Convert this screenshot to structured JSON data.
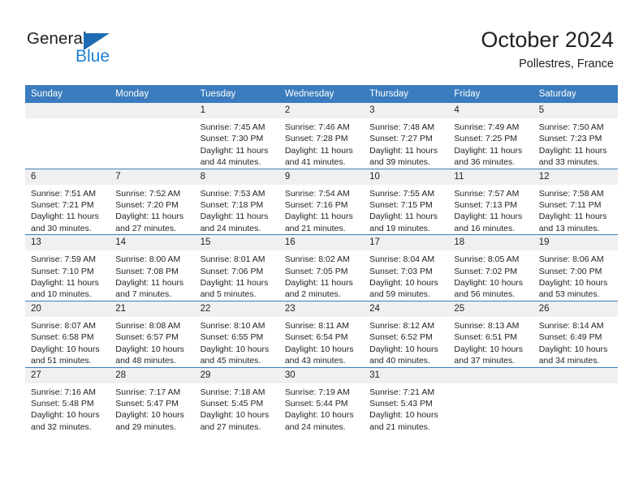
{
  "brand": {
    "name_part1": "General",
    "name_part2": "Blue",
    "color_dark": "#231f20",
    "color_blue": "#1f7fd0",
    "triangle_color": "#1f6cb4"
  },
  "header": {
    "title": "October 2024",
    "subtitle": "Pollestres, France"
  },
  "theme": {
    "header_blue": "#3a7cbe",
    "daynum_bg": "#f0f0f0",
    "cell_bg": "#ffffff",
    "text": "#231f20"
  },
  "weekdays": [
    "Sunday",
    "Monday",
    "Tuesday",
    "Wednesday",
    "Thursday",
    "Friday",
    "Saturday"
  ],
  "weeks": [
    [
      {
        "day": "",
        "sunrise": "",
        "sunset": "",
        "daylight": "",
        "empty": true
      },
      {
        "day": "",
        "sunrise": "",
        "sunset": "",
        "daylight": "",
        "empty": true
      },
      {
        "day": "1",
        "sunrise": "Sunrise: 7:45 AM",
        "sunset": "Sunset: 7:30 PM",
        "daylight": "Daylight: 11 hours and 44 minutes.",
        "empty": false
      },
      {
        "day": "2",
        "sunrise": "Sunrise: 7:46 AM",
        "sunset": "Sunset: 7:28 PM",
        "daylight": "Daylight: 11 hours and 41 minutes.",
        "empty": false
      },
      {
        "day": "3",
        "sunrise": "Sunrise: 7:48 AM",
        "sunset": "Sunset: 7:27 PM",
        "daylight": "Daylight: 11 hours and 39 minutes.",
        "empty": false
      },
      {
        "day": "4",
        "sunrise": "Sunrise: 7:49 AM",
        "sunset": "Sunset: 7:25 PM",
        "daylight": "Daylight: 11 hours and 36 minutes.",
        "empty": false
      },
      {
        "day": "5",
        "sunrise": "Sunrise: 7:50 AM",
        "sunset": "Sunset: 7:23 PM",
        "daylight": "Daylight: 11 hours and 33 minutes.",
        "empty": false
      }
    ],
    [
      {
        "day": "6",
        "sunrise": "Sunrise: 7:51 AM",
        "sunset": "Sunset: 7:21 PM",
        "daylight": "Daylight: 11 hours and 30 minutes.",
        "empty": false
      },
      {
        "day": "7",
        "sunrise": "Sunrise: 7:52 AM",
        "sunset": "Sunset: 7:20 PM",
        "daylight": "Daylight: 11 hours and 27 minutes.",
        "empty": false
      },
      {
        "day": "8",
        "sunrise": "Sunrise: 7:53 AM",
        "sunset": "Sunset: 7:18 PM",
        "daylight": "Daylight: 11 hours and 24 minutes.",
        "empty": false
      },
      {
        "day": "9",
        "sunrise": "Sunrise: 7:54 AM",
        "sunset": "Sunset: 7:16 PM",
        "daylight": "Daylight: 11 hours and 21 minutes.",
        "empty": false
      },
      {
        "day": "10",
        "sunrise": "Sunrise: 7:55 AM",
        "sunset": "Sunset: 7:15 PM",
        "daylight": "Daylight: 11 hours and 19 minutes.",
        "empty": false
      },
      {
        "day": "11",
        "sunrise": "Sunrise: 7:57 AM",
        "sunset": "Sunset: 7:13 PM",
        "daylight": "Daylight: 11 hours and 16 minutes.",
        "empty": false
      },
      {
        "day": "12",
        "sunrise": "Sunrise: 7:58 AM",
        "sunset": "Sunset: 7:11 PM",
        "daylight": "Daylight: 11 hours and 13 minutes.",
        "empty": false
      }
    ],
    [
      {
        "day": "13",
        "sunrise": "Sunrise: 7:59 AM",
        "sunset": "Sunset: 7:10 PM",
        "daylight": "Daylight: 11 hours and 10 minutes.",
        "empty": false
      },
      {
        "day": "14",
        "sunrise": "Sunrise: 8:00 AM",
        "sunset": "Sunset: 7:08 PM",
        "daylight": "Daylight: 11 hours and 7 minutes.",
        "empty": false
      },
      {
        "day": "15",
        "sunrise": "Sunrise: 8:01 AM",
        "sunset": "Sunset: 7:06 PM",
        "daylight": "Daylight: 11 hours and 5 minutes.",
        "empty": false
      },
      {
        "day": "16",
        "sunrise": "Sunrise: 8:02 AM",
        "sunset": "Sunset: 7:05 PM",
        "daylight": "Daylight: 11 hours and 2 minutes.",
        "empty": false
      },
      {
        "day": "17",
        "sunrise": "Sunrise: 8:04 AM",
        "sunset": "Sunset: 7:03 PM",
        "daylight": "Daylight: 10 hours and 59 minutes.",
        "empty": false
      },
      {
        "day": "18",
        "sunrise": "Sunrise: 8:05 AM",
        "sunset": "Sunset: 7:02 PM",
        "daylight": "Daylight: 10 hours and 56 minutes.",
        "empty": false
      },
      {
        "day": "19",
        "sunrise": "Sunrise: 8:06 AM",
        "sunset": "Sunset: 7:00 PM",
        "daylight": "Daylight: 10 hours and 53 minutes.",
        "empty": false
      }
    ],
    [
      {
        "day": "20",
        "sunrise": "Sunrise: 8:07 AM",
        "sunset": "Sunset: 6:58 PM",
        "daylight": "Daylight: 10 hours and 51 minutes.",
        "empty": false
      },
      {
        "day": "21",
        "sunrise": "Sunrise: 8:08 AM",
        "sunset": "Sunset: 6:57 PM",
        "daylight": "Daylight: 10 hours and 48 minutes.",
        "empty": false
      },
      {
        "day": "22",
        "sunrise": "Sunrise: 8:10 AM",
        "sunset": "Sunset: 6:55 PM",
        "daylight": "Daylight: 10 hours and 45 minutes.",
        "empty": false
      },
      {
        "day": "23",
        "sunrise": "Sunrise: 8:11 AM",
        "sunset": "Sunset: 6:54 PM",
        "daylight": "Daylight: 10 hours and 43 minutes.",
        "empty": false
      },
      {
        "day": "24",
        "sunrise": "Sunrise: 8:12 AM",
        "sunset": "Sunset: 6:52 PM",
        "daylight": "Daylight: 10 hours and 40 minutes.",
        "empty": false
      },
      {
        "day": "25",
        "sunrise": "Sunrise: 8:13 AM",
        "sunset": "Sunset: 6:51 PM",
        "daylight": "Daylight: 10 hours and 37 minutes.",
        "empty": false
      },
      {
        "day": "26",
        "sunrise": "Sunrise: 8:14 AM",
        "sunset": "Sunset: 6:49 PM",
        "daylight": "Daylight: 10 hours and 34 minutes.",
        "empty": false
      }
    ],
    [
      {
        "day": "27",
        "sunrise": "Sunrise: 7:16 AM",
        "sunset": "Sunset: 5:48 PM",
        "daylight": "Daylight: 10 hours and 32 minutes.",
        "empty": false
      },
      {
        "day": "28",
        "sunrise": "Sunrise: 7:17 AM",
        "sunset": "Sunset: 5:47 PM",
        "daylight": "Daylight: 10 hours and 29 minutes.",
        "empty": false
      },
      {
        "day": "29",
        "sunrise": "Sunrise: 7:18 AM",
        "sunset": "Sunset: 5:45 PM",
        "daylight": "Daylight: 10 hours and 27 minutes.",
        "empty": false
      },
      {
        "day": "30",
        "sunrise": "Sunrise: 7:19 AM",
        "sunset": "Sunset: 5:44 PM",
        "daylight": "Daylight: 10 hours and 24 minutes.",
        "empty": false
      },
      {
        "day": "31",
        "sunrise": "Sunrise: 7:21 AM",
        "sunset": "Sunset: 5:43 PM",
        "daylight": "Daylight: 10 hours and 21 minutes.",
        "empty": false
      },
      {
        "day": "",
        "sunrise": "",
        "sunset": "",
        "daylight": "",
        "empty": true
      },
      {
        "day": "",
        "sunrise": "",
        "sunset": "",
        "daylight": "",
        "empty": true
      }
    ]
  ]
}
